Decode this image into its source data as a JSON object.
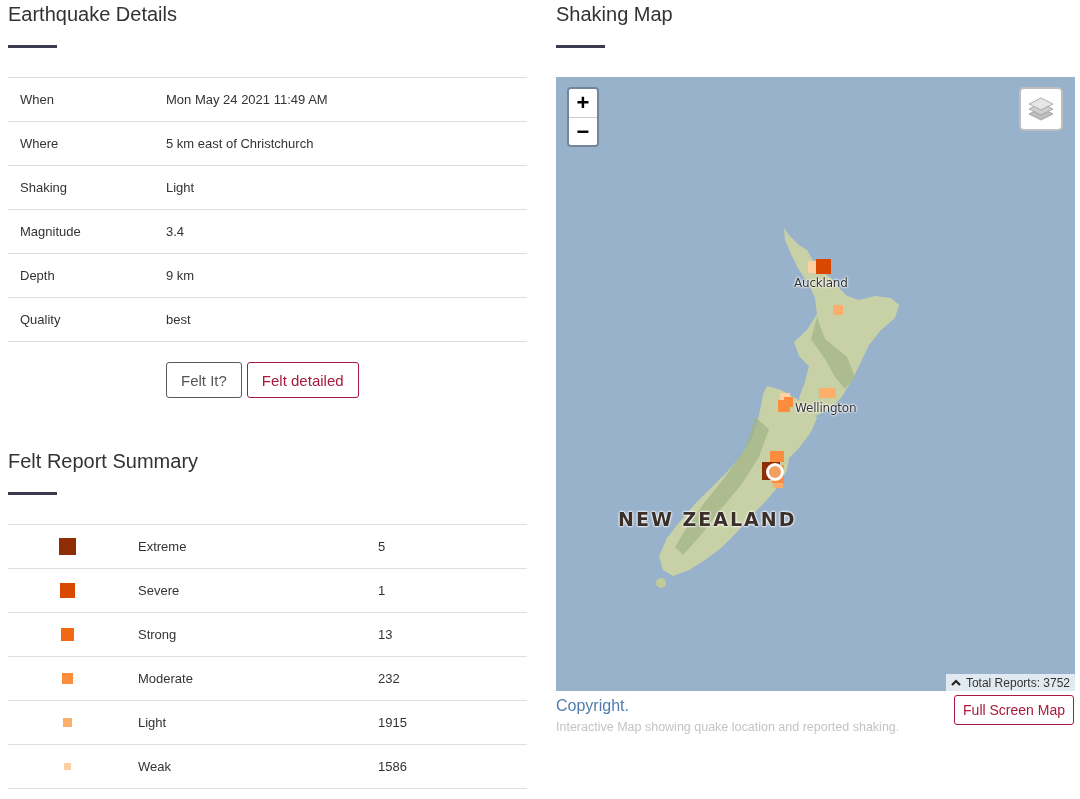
{
  "earthquake_details": {
    "title": "Earthquake Details",
    "rows": [
      {
        "label": "When",
        "value": "Mon May 24 2021 11:49 AM"
      },
      {
        "label": "Where",
        "value": "5 km east of Christchurch"
      },
      {
        "label": "Shaking",
        "value": "Light"
      },
      {
        "label": "Magnitude",
        "value": "3.4"
      },
      {
        "label": "Depth",
        "value": "9 km"
      },
      {
        "label": "Quality",
        "value": "best"
      }
    ],
    "buttons": [
      {
        "label": "Felt It?",
        "kind": "neutral"
      },
      {
        "label": "Felt detailed",
        "kind": "accent"
      }
    ]
  },
  "felt_report_summary": {
    "title": "Felt Report Summary",
    "rows": [
      {
        "intensity": "Extreme",
        "count": "5",
        "color": "#8c2d04"
      },
      {
        "intensity": "Severe",
        "count": "1",
        "color": "#d94801"
      },
      {
        "intensity": "Strong",
        "count": "13",
        "color": "#f16913"
      },
      {
        "intensity": "Moderate",
        "count": "232",
        "color": "#fd8d3c"
      },
      {
        "intensity": "Light",
        "count": "1915",
        "color": "#fdae6b"
      },
      {
        "intensity": "Weak",
        "count": "1586",
        "color": "#fdd0a2"
      }
    ]
  },
  "shaking_map": {
    "title": "Shaking Map",
    "zoom_buttons": [
      {
        "label": "+"
      },
      {
        "label": "−"
      }
    ],
    "labels": [
      {
        "text": "Auckland",
        "kind": "city"
      },
      {
        "text": "Wellington",
        "kind": "city"
      },
      {
        "text": "NEW ZEALAND",
        "kind": "country"
      }
    ],
    "total_reports": "Total Reports: 3752",
    "copyright_link": "Copyright.",
    "caption": "Interactive Map showing quake location and reported shaking.",
    "full_screen_button": "Full Screen Map"
  }
}
